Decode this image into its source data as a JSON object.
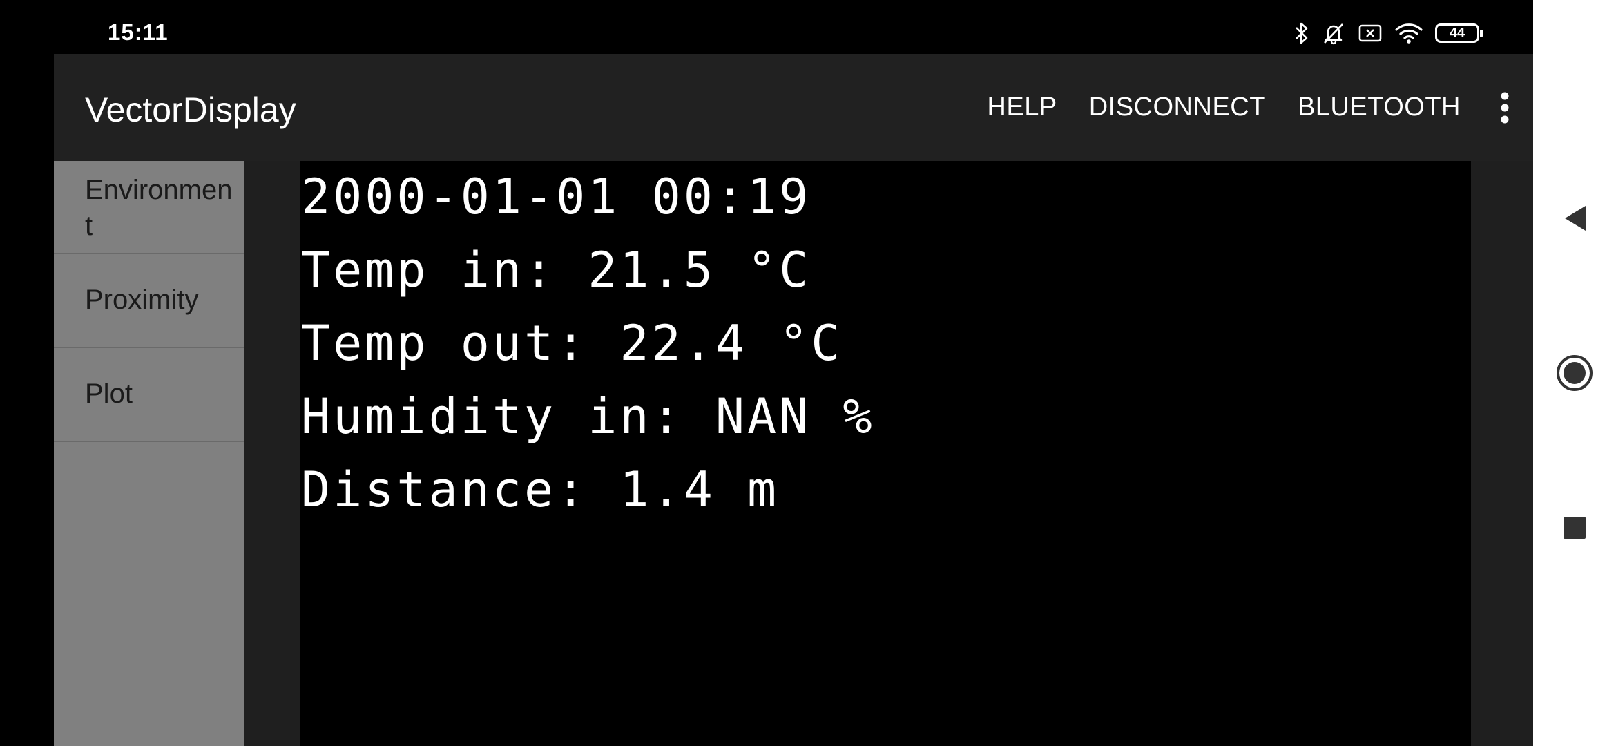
{
  "status_bar": {
    "time": "15:11",
    "battery_level": "44",
    "icons": [
      "bluetooth-icon",
      "bell-off-icon",
      "no-sim-icon",
      "wifi-icon",
      "battery-icon"
    ]
  },
  "app_bar": {
    "title": "VectorDisplay",
    "actions": {
      "help": "HELP",
      "disconnect": "DISCONNECT",
      "bluetooth": "BLUETOOTH"
    },
    "overflow_icon": "more-vert-icon"
  },
  "sidebar": {
    "items": [
      {
        "label": "Environment"
      },
      {
        "label": "Proximity"
      },
      {
        "label": "Plot"
      }
    ]
  },
  "display": {
    "lines": [
      "2000-01-01 00:19",
      "Temp in: 21.5 °C",
      "Temp out: 22.4 °C",
      "Humidity in: NAN %",
      "Distance: 1.4 m"
    ]
  },
  "nav_bar": {
    "icons": [
      "back-icon",
      "home-icon",
      "recents-icon"
    ]
  },
  "colors": {
    "app_bar": "#212121",
    "sidebar": "#808080",
    "display_bg": "#000000",
    "display_text": "#ffffff",
    "nav_bar": "#ffffff"
  }
}
